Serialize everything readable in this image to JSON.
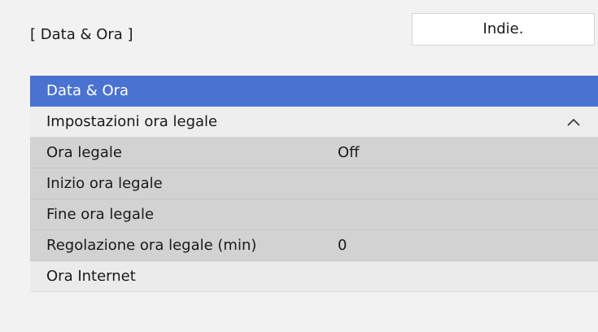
{
  "header": {
    "title": "[ Data & Ora ]",
    "back_label": "Indie."
  },
  "menu": {
    "items": [
      {
        "label": "Data & Ora",
        "value": "",
        "state": "selected"
      },
      {
        "label": "Impostazioni ora legale",
        "value": "",
        "state": "expanded",
        "icon": "chevron-up-icon"
      },
      {
        "label": "Ora legale",
        "value": "Off",
        "state": "sub"
      },
      {
        "label": "Inizio ora legale",
        "value": "",
        "state": "sub"
      },
      {
        "label": "Fine ora legale",
        "value": "",
        "state": "sub"
      },
      {
        "label": "Regolazione ora legale (min)",
        "value": "0",
        "state": "sub"
      },
      {
        "label": "Ora Internet",
        "value": "",
        "state": "plain"
      }
    ]
  },
  "colors": {
    "selected": "#4a72d0",
    "submenu": "#d2d2d2",
    "background": "#f2f2f2"
  }
}
